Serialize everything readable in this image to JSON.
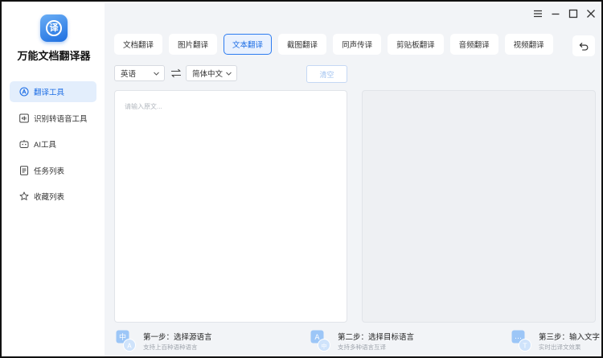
{
  "app": {
    "title": "万能文档翻译器",
    "logo_glyph": "译",
    "accent": "#1f6fe5"
  },
  "sidebar": {
    "items": [
      {
        "label": "翻译工具",
        "icon": "translate-icon",
        "active": true
      },
      {
        "label": "识别转语音工具",
        "icon": "audio-wave-icon",
        "active": false
      },
      {
        "label": "AI工具",
        "icon": "robot-icon",
        "active": false
      },
      {
        "label": "任务列表",
        "icon": "task-list-icon",
        "active": false
      },
      {
        "label": "收藏列表",
        "icon": "star-icon",
        "active": false
      }
    ]
  },
  "window_controls": [
    "menu-icon",
    "minimize-icon",
    "maximize-icon",
    "close-icon"
  ],
  "tabs": [
    {
      "label": "文档翻译",
      "active": false
    },
    {
      "label": "图片翻译",
      "active": false
    },
    {
      "label": "文本翻译",
      "active": true
    },
    {
      "label": "截图翻译",
      "active": false
    },
    {
      "label": "同声传译",
      "active": false
    },
    {
      "label": "剪贴板翻译",
      "active": false
    },
    {
      "label": "音频翻译",
      "active": false
    },
    {
      "label": "视频翻译",
      "active": false
    }
  ],
  "language": {
    "source": "英语",
    "target": "简体中文",
    "clear_label": "清空"
  },
  "editor": {
    "placeholder": "请输入原文..."
  },
  "steps": [
    {
      "title": "第一步：选择源语言",
      "sub": "支持上百种语种语言",
      "icon_glyph": "中",
      "icon_badge": "A"
    },
    {
      "title": "第二步：选择目标语言",
      "sub": "支持多种语言互译",
      "icon_glyph": "A",
      "icon_badge": "中"
    },
    {
      "title": "第三步：输入文字",
      "sub": "实时出译文效果",
      "icon_glyph": "…",
      "icon_badge": "T"
    }
  ]
}
